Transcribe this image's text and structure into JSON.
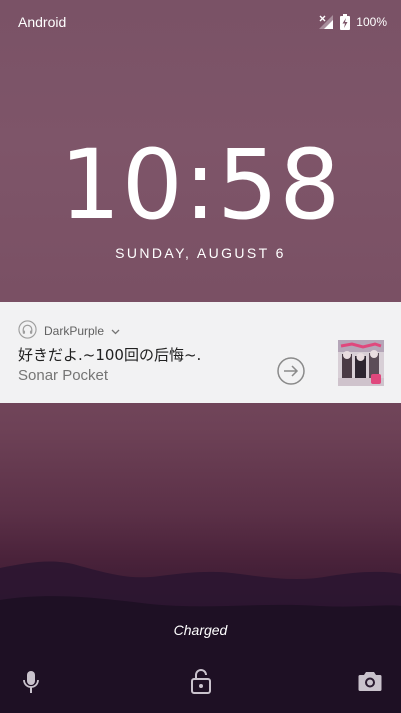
{
  "status_bar": {
    "carrier": "Android",
    "battery_percent": "100%",
    "signal_icon": "signal-no-service-icon",
    "battery_icon": "battery-charging-icon"
  },
  "lockscreen": {
    "time": "10:58",
    "date": "SUNDAY, AUGUST 6",
    "charging_status": "Charged"
  },
  "notification": {
    "app_icon": "headphones-icon",
    "app_name": "DarkPurple",
    "title": "好きだよ.~100回の后悔~.",
    "text": "Sonar Pocket",
    "action_icon": "arrow-right-circle-icon",
    "album_art_icon": "album-art"
  },
  "shortcuts": {
    "left": "microphone-icon",
    "center": "lock-icon",
    "right": "camera-icon"
  },
  "colors": {
    "notification_background": "#f2f2f3",
    "wallpaper_top": "#7a5266",
    "wallpaper_bottom": "#1a0f24"
  }
}
